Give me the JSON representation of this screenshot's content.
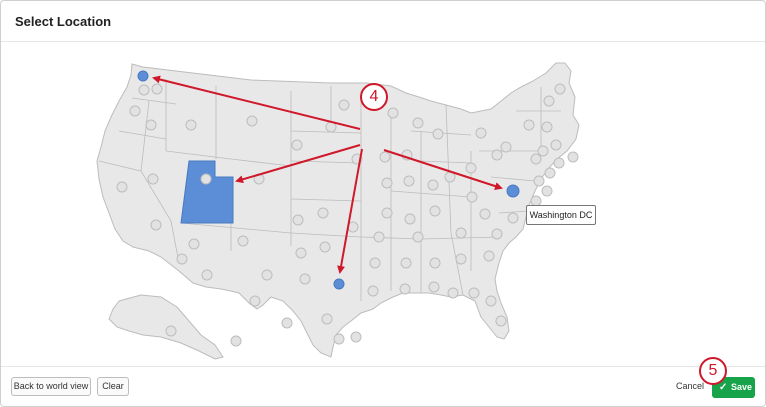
{
  "dialog": {
    "title": "Select Location"
  },
  "map": {
    "selected_state": "Utah",
    "tooltip": "Washington DC",
    "fill_color": "#e8e8e8",
    "border_color": "#bcbcbc",
    "selected_color": "#5b8ed6",
    "marker_color": "#5b8ed6",
    "arrow_color": "#d0182a"
  },
  "annotations": {
    "step_a": "4",
    "step_b": "5"
  },
  "footer": {
    "back_label": "Back to world view",
    "clear_label": "Clear",
    "cancel_label": "Cancel",
    "save_label": "Save",
    "save_color": "#16a34a",
    "save_icon": "check-icon"
  }
}
